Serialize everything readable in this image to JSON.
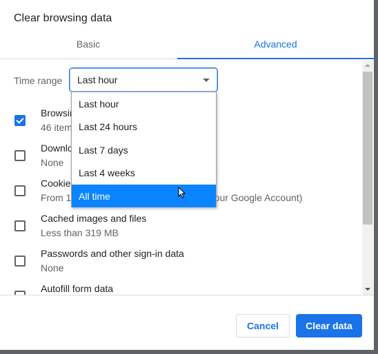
{
  "dialog": {
    "title": "Clear browsing data"
  },
  "tabs": [
    {
      "label": "Basic",
      "active": false
    },
    {
      "label": "Advanced",
      "active": true
    }
  ],
  "time_range": {
    "label": "Time range",
    "value": "Last hour",
    "options": [
      "Last hour",
      "Last 24 hours",
      "Last 7 days",
      "Last 4 weeks",
      "All time"
    ],
    "highlighted": "All time"
  },
  "items": [
    {
      "title": "Browsing history",
      "subtitle": "46 items",
      "checked": true
    },
    {
      "title": "Download history",
      "subtitle": "None",
      "checked": false
    },
    {
      "title": "Cookies and other site data",
      "subtitle": "From 1 site (you won't be signed out of your Google Account)",
      "checked": false
    },
    {
      "title": "Cached images and files",
      "subtitle": "Less than 319 MB",
      "checked": false
    },
    {
      "title": "Passwords and other sign-in data",
      "subtitle": "None",
      "checked": false
    },
    {
      "title": "Autofill form data",
      "subtitle": "",
      "checked": false
    }
  ],
  "footer": {
    "cancel": "Cancel",
    "clear": "Clear data"
  },
  "colors": {
    "accent": "#1a73e8",
    "highlight": "#0a84ff"
  }
}
